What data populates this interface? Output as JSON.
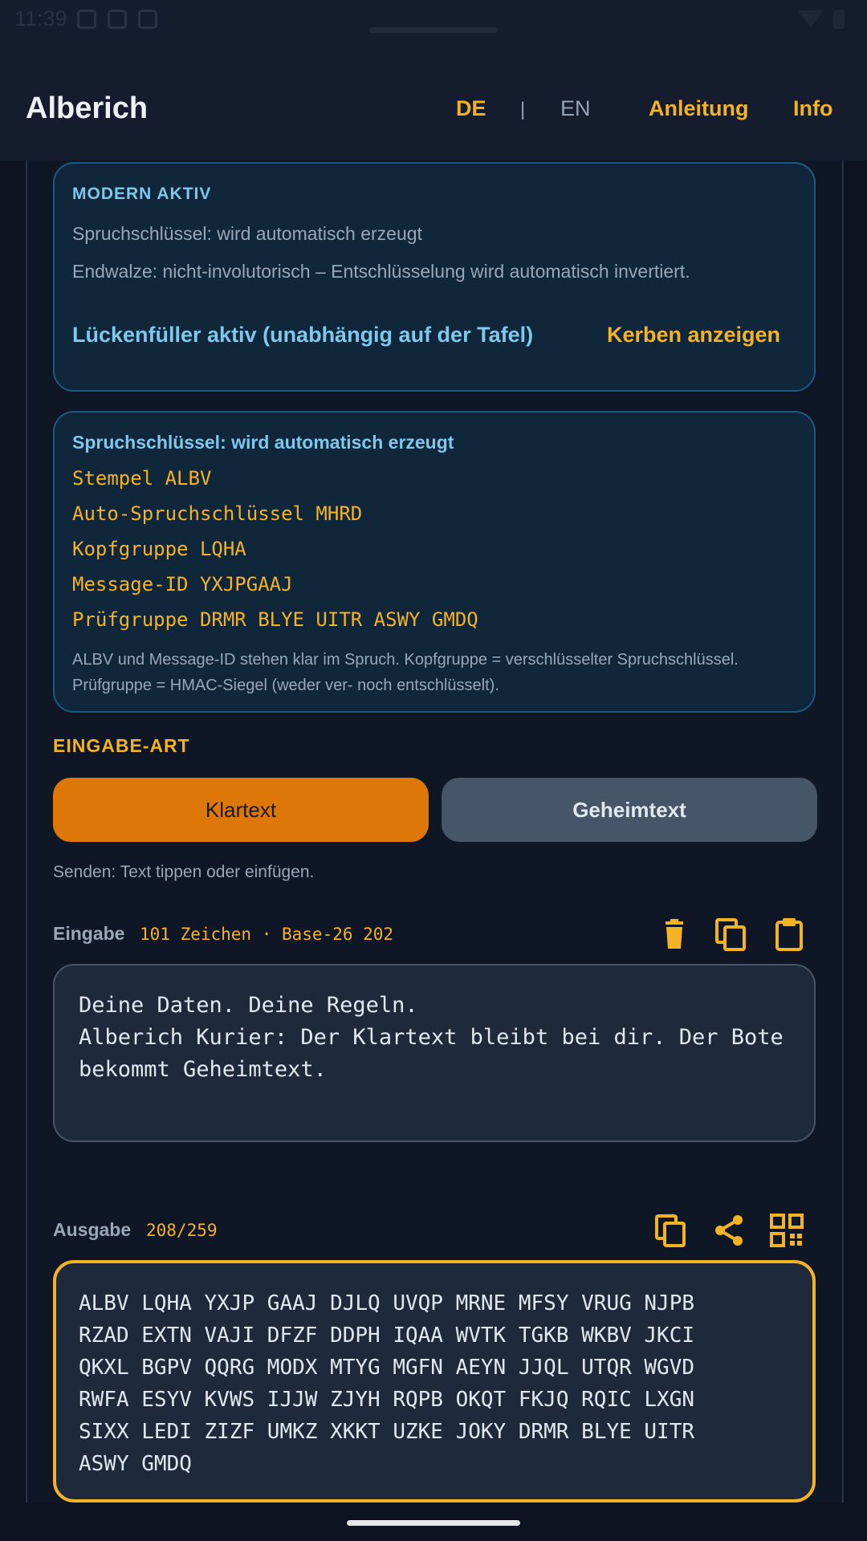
{
  "status": {
    "time": "11:39"
  },
  "appbar": {
    "title": "Alberich",
    "lang_de": "DE",
    "lang_sep": "|",
    "lang_en": "EN",
    "nav_anleitung": "Anleitung",
    "nav_info": "Info"
  },
  "mode_card": {
    "label": "MODERN AKTIV",
    "line1": "Spruchschlüssel: wird automatisch erzeugt",
    "line2": "Endwalze: nicht-involutorisch – Entschlüsselung wird automatisch invertiert.",
    "filler": "Lückenfüller aktiv (unabhängig auf der Tafel)",
    "kerben": "Kerben anzeigen"
  },
  "key_card": {
    "header": "Spruchschlüssel: wird automatisch erzeugt",
    "stempel": "Stempel ALBV",
    "auto_key": "Auto-Spruchschlüssel MHRD",
    "kopfgruppe": "Kopfgruppe LQHA",
    "message_id": "Message-ID YXJPGAAJ",
    "pruefgruppe": "Prüfgruppe DRMR BLYE UITR ASWY GMDQ",
    "note": "ALBV und Message-ID stehen klar im Spruch. Kopfgruppe = verschlüsselter Spruchschlüssel. Prüfgruppe = HMAC-Siegel (weder ver- noch entschlüsselt)."
  },
  "input_mode": {
    "label": "EINGABE-ART",
    "klartext": "Klartext",
    "geheimtext": "Geheimtext",
    "selected": "Klartext",
    "hint": "Senden: Text tippen oder einfügen."
  },
  "input": {
    "label": "Eingabe",
    "count": "101 Zeichen · Base-26 202",
    "text": "Deine Daten. Deine Regeln.\nAlberich Kurier: Der Klartext bleibt bei dir. Der Bote bekommt Geheimtext.",
    "icons": [
      "trash-icon",
      "copy-icon",
      "paste-icon"
    ]
  },
  "output": {
    "label": "Ausgabe",
    "count": "208/259",
    "text": "ALBV LQHA YXJP GAAJ DJLQ UVQP MRNE MFSY VRUG NJPB\nRZAD EXTN VAJI DFZF DDPH IQAA WVTK TGKB WKBV JKCI\nQKXL BGPV QQRG MODX MTYG MGFN AEYN JJQL UTQR WGVD\nRWFA ESYV KVWS IJJW ZJYH RQPB OKQT FKJQ RQIC LXGN\nSIXX LEDI ZIZF UMKZ XKKT UZKE JOKY DRMR BLYE UITR\nASWY GMDQ",
    "icons": [
      "copy-icon",
      "share-icon",
      "qr-code-icon"
    ]
  },
  "colors": {
    "accent": "#f3b324",
    "primary_button": "#dc7708",
    "info_blue": "#7ec8ec",
    "background": "#0d1321"
  }
}
